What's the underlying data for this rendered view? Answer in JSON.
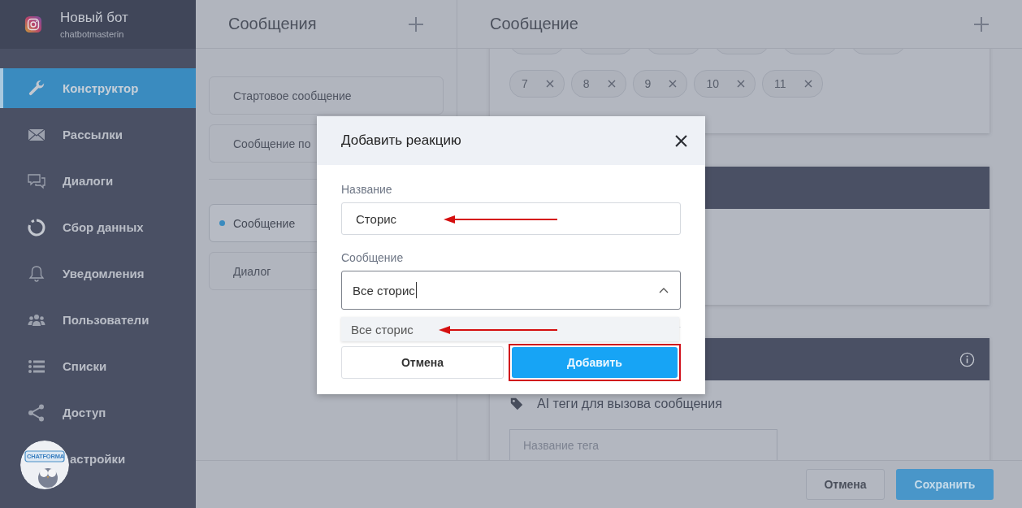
{
  "sidebar": {
    "bot_name": "Новый бот",
    "account": "chatbotmasterin",
    "items": [
      {
        "label": "Конструктор",
        "selected": true
      },
      {
        "label": "Рассылки",
        "selected": false
      },
      {
        "label": "Диалоги",
        "selected": false
      },
      {
        "label": "Сбор данных",
        "selected": false
      },
      {
        "label": "Уведомления",
        "selected": false
      },
      {
        "label": "Пользователи",
        "selected": false
      },
      {
        "label": "Списки",
        "selected": false
      },
      {
        "label": "Доступ",
        "selected": false
      },
      {
        "label": "астройки",
        "selected": false
      }
    ]
  },
  "widget": {
    "label": "CHATFORMA"
  },
  "messages_panel": {
    "title": "Сообщения",
    "system_items": [
      {
        "label": "Стартовое сообщение",
        "selected": false
      },
      {
        "label": "Сообщение по",
        "selected": false
      }
    ],
    "items": [
      {
        "label": "Сообщение",
        "selected": true
      },
      {
        "label": "Диалог",
        "selected": false
      }
    ]
  },
  "editor": {
    "title": "Сообщение",
    "chips": [
      "7",
      "8",
      "9",
      "10",
      "11"
    ],
    "tags_heading": "AI теги для вызова сообщения",
    "tag_placeholder": "Название тега"
  },
  "footer": {
    "cancel": "Отмена",
    "save": "Сохранить"
  },
  "dialog": {
    "title": "Добавить реакцию",
    "name_label": "Название",
    "name_value": "Сторис",
    "message_label": "Сообщение",
    "message_value": "Все сторис",
    "expanded": true,
    "options": [
      {
        "label": "Все сторис",
        "selected": true
      }
    ],
    "cancel": "Отмена",
    "submit": "Добавить"
  }
}
